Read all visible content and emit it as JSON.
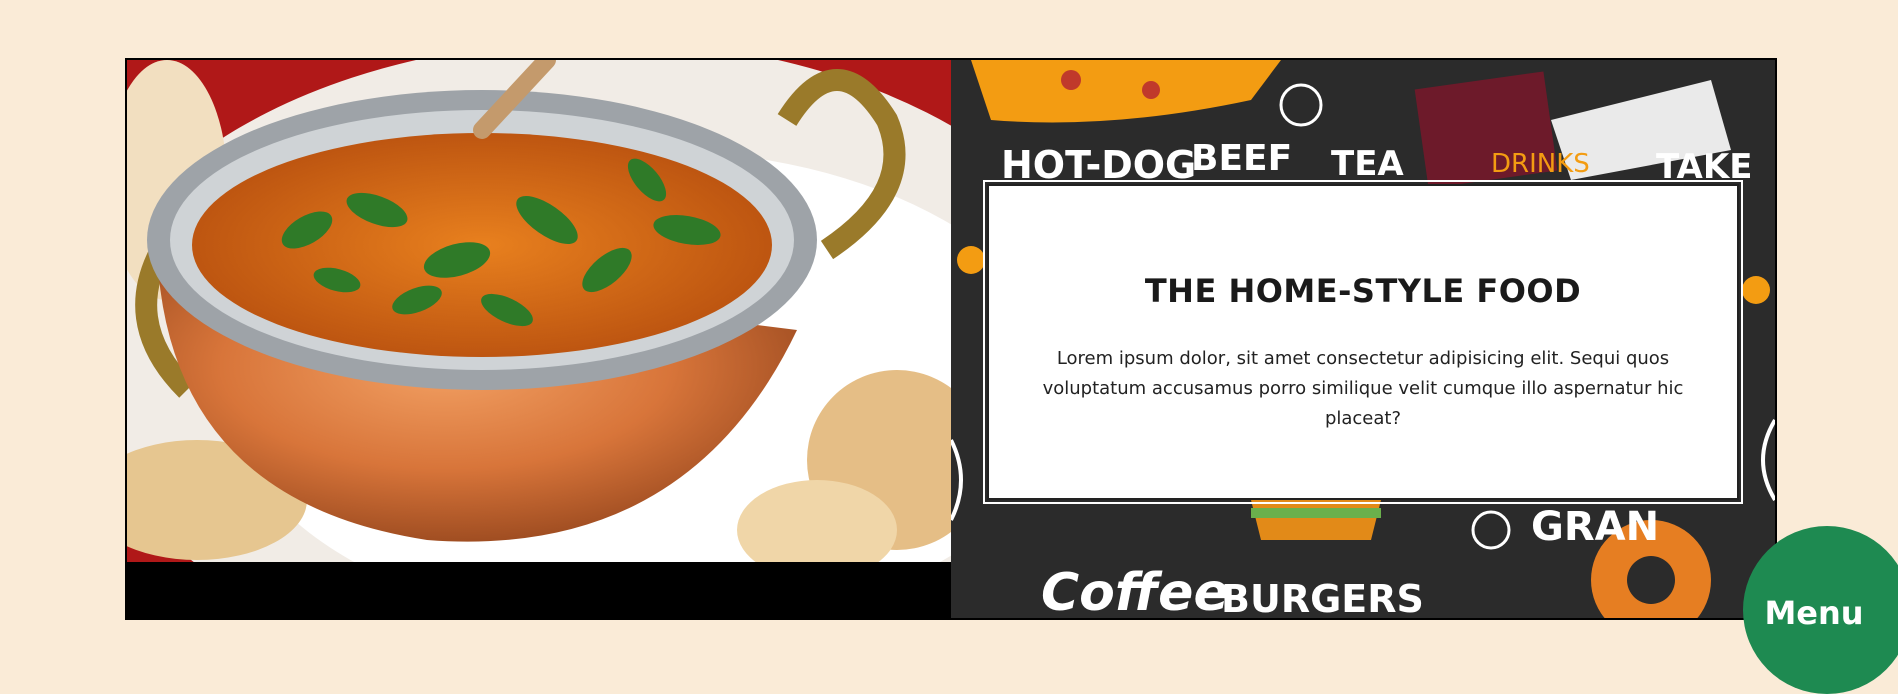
{
  "feature": {
    "photo_alt": "Curry in a copper bowl with naan",
    "card": {
      "title": "THE HOME-STYLE FOOD",
      "body": "Lorem ipsum dolor, sit amet consectetur adipisicing elit. Sequi quos voluptatum accusamus porro similique velit cumque illo aspernatur hic placeat?"
    },
    "pattern_words": [
      "HOT-DOG",
      "BEEF",
      "TEA",
      "TAKE",
      "Coffee",
      "BURGERS",
      "GRAN",
      "DRINKS"
    ]
  },
  "menu_button": {
    "label": "Menu"
  },
  "colors": {
    "page_background": "#faebd7",
    "menu_button": "#1e8a51",
    "pattern_background": "#2b2b2b",
    "accent_orange": "#f39c12"
  }
}
